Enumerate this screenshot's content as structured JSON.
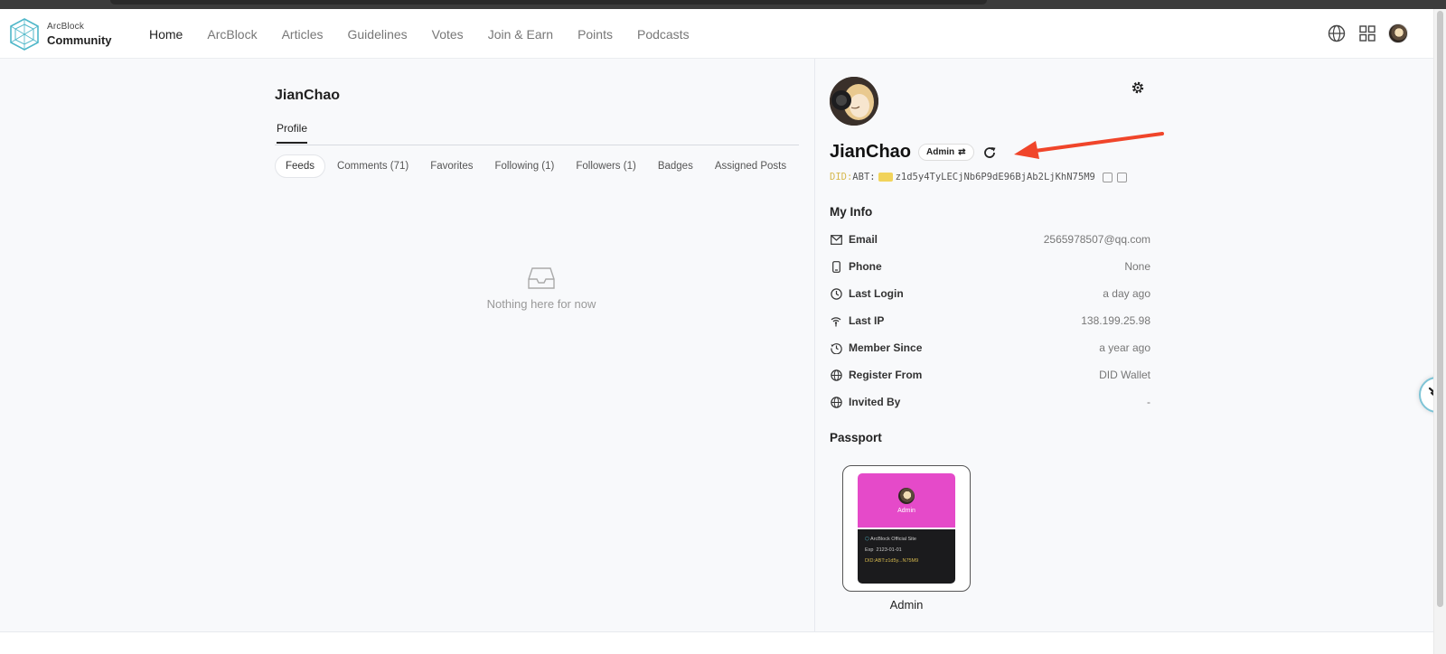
{
  "nav": {
    "logo_small": "ArcBlock",
    "logo_big": "Community",
    "items": [
      "Home",
      "ArcBlock",
      "Articles",
      "Guidelines",
      "Votes",
      "Join & Earn",
      "Points",
      "Podcasts"
    ]
  },
  "left": {
    "user_title": "JianChao",
    "profile_tab": "Profile",
    "subtabs": [
      "Feeds",
      "Comments (71)",
      "Favorites",
      "Following (1)",
      "Followers (1)",
      "Badges",
      "Assigned Posts"
    ],
    "empty_text": "Nothing here for now"
  },
  "right": {
    "name": "JianChao",
    "role_badge": "Admin",
    "did_prefix": "DID:",
    "did_type": "ABT:",
    "did_value": "z1d5y4TyLECjNb6P9dE96BjAb2LjKhN75M9",
    "my_info_title": "My Info",
    "info": [
      {
        "label": "Email",
        "value": "2565978507@qq.com",
        "icon": "mail-icon"
      },
      {
        "label": "Phone",
        "value": "None",
        "icon": "phone-icon"
      },
      {
        "label": "Last Login",
        "value": "a day ago",
        "icon": "clock-icon"
      },
      {
        "label": "Last IP",
        "value": "138.199.25.98",
        "icon": "antenna-icon"
      },
      {
        "label": "Member Since",
        "value": "a year ago",
        "icon": "history-icon"
      },
      {
        "label": "Register From",
        "value": "DID Wallet",
        "icon": "globe-icon"
      },
      {
        "label": "Invited By",
        "value": "-",
        "icon": "globe-icon"
      }
    ],
    "passport_title": "Passport",
    "passport": {
      "role": "Admin",
      "site": "ArcBlock Official Site",
      "exp_label": "Exp",
      "exp_value": "2123-01-01",
      "did_short": "DID:ABT:z1d5y...N75M9",
      "label": "Admin"
    }
  },
  "colors": {
    "accent_arrow": "#f0452a",
    "passport_pink": "#e54ac9",
    "did_gold": "#d6b94e"
  }
}
